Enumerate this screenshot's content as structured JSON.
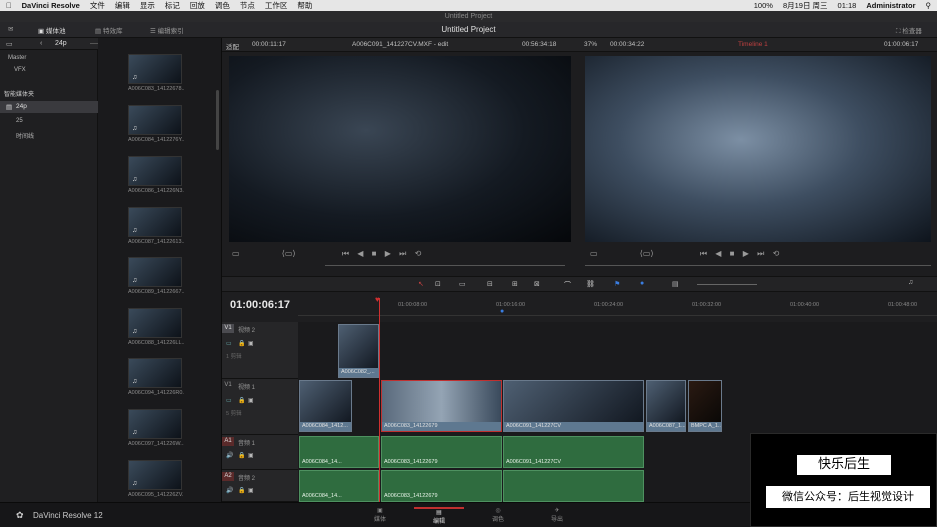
{
  "menubar": {
    "app_name": "DaVinci Resolve",
    "items": [
      "文件",
      "编辑",
      "显示",
      "标记",
      "回放",
      "调色",
      "节点",
      "工作区",
      "帮助"
    ],
    "status": "100%",
    "date": "8月19日 周三",
    "time": "01:18",
    "user": "Administrator"
  },
  "window_title": "Untitled Project",
  "top_toolbar": {
    "media_pool": "媒体池",
    "effects": "特效库",
    "edit_index": "编辑索引",
    "project_title": "Untitled Project",
    "inspector": "检查器"
  },
  "left_panel": {
    "fps_label": "24p",
    "master": "Master",
    "vfx": "VFX",
    "smart_bins": "智能媒体夹",
    "bins": [
      "24p",
      "25",
      "时间线"
    ]
  },
  "bin_clips": [
    "A006C083_14122678...",
    "A006C084_1412276Y...",
    "A006C086_141226N3...",
    "A006C087_14122613...",
    "A006C089_14122667...",
    "A006C088_141226LL...",
    "A006C094_141226R0...",
    "A006C097_141226W...",
    "A006C095_141226ZV..."
  ],
  "source_viewer": {
    "fit": "适配",
    "timecode": "00:00:11:17",
    "clip_name": "A006C091_141227CV.MXF - edit",
    "duration": "00:56:34:18"
  },
  "program_viewer": {
    "zoom": "37%",
    "timecode": "00:00:34:22",
    "timeline_name": "Timeline 1",
    "position": "01:00:06:17"
  },
  "timeline": {
    "current_tc": "01:00:06:17",
    "ruler": [
      "01:00:08:00",
      "01:00:16:00",
      "01:00:24:00",
      "01:00:32:00",
      "01:00:40:00",
      "01:00:48:00"
    ],
    "tracks": [
      {
        "tag": "V1",
        "name": "视频 2",
        "sub": "1 剪辑"
      },
      {
        "tag": "V1",
        "name": "视频 1",
        "sub": "5 剪辑"
      },
      {
        "tag": "A1",
        "name": "音频 1",
        "sub": ""
      },
      {
        "tag": "A2",
        "name": "音频 2",
        "sub": ""
      }
    ],
    "v2_clips": [
      "A006C082_..."
    ],
    "v1_clips": [
      "A006C084_1412...",
      "A006C083_14122679",
      "A006C091_141227CV",
      "A006C087_1...",
      "BMPC A_1..."
    ],
    "a1_clips": [
      "A006C084_14...",
      "A006C083_14122679",
      "A006C091_141227CV"
    ],
    "a2_clips": [
      "A006C084_14...",
      "A006C083_14122679"
    ]
  },
  "bottom": {
    "app_version": "DaVinci Resolve 12",
    "pages": [
      "媒体",
      "编辑",
      "调色",
      "导出"
    ]
  },
  "overlay": {
    "title": "快乐后生",
    "subtitle": "微信公众号：后生视觉设计"
  }
}
